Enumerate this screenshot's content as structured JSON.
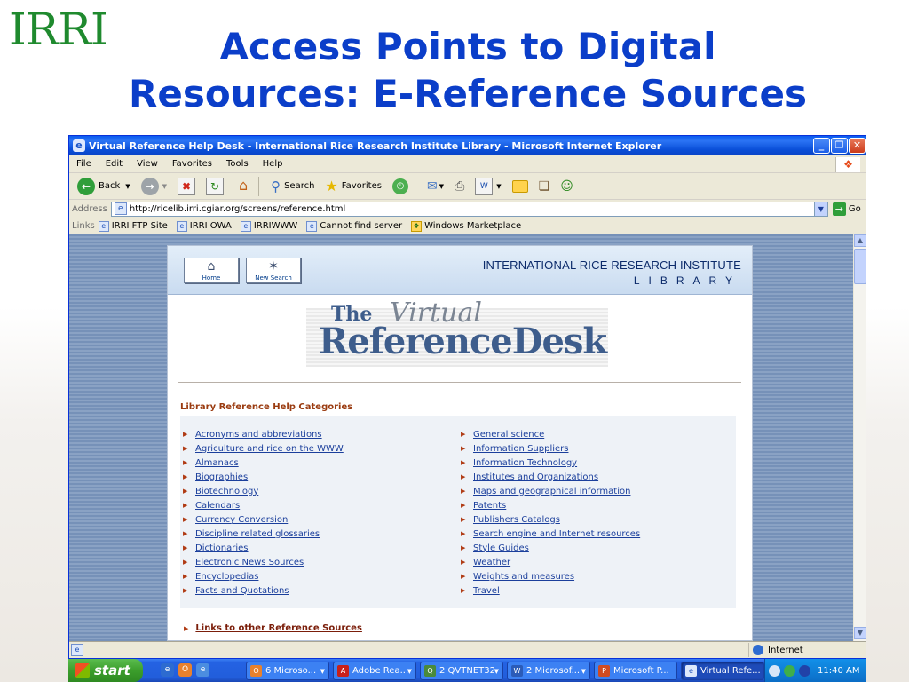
{
  "slide": {
    "logo_text": "IRRI",
    "title_line1": "Access Points to Digital",
    "title_line2": "Resources: E-Reference Sources"
  },
  "window": {
    "title": "Virtual Reference Help Desk - International Rice Research Institute Library - Microsoft Internet Explorer",
    "controls": [
      "minimize",
      "restore",
      "close"
    ]
  },
  "menu": [
    "File",
    "Edit",
    "View",
    "Favorites",
    "Tools",
    "Help"
  ],
  "toolbar": {
    "back": "Back",
    "search": "Search",
    "favorites": "Favorites"
  },
  "address": {
    "label": "Address",
    "url": "http://ricelib.irri.cgiar.org/screens/reference.html",
    "go": "Go"
  },
  "links": {
    "label": "Links",
    "items": [
      "IRRI FTP Site",
      "IRRI OWA",
      "IRRIWWW",
      "Cannot find server",
      "Windows Marketplace"
    ]
  },
  "page": {
    "home_btn": "Home",
    "newsearch_btn": "New Search",
    "institute": "INTERNATIONAL RICE RESEARCH INSTITUTE",
    "library": "LIBRARY",
    "logo_the": "The",
    "logo_virtual": "Virtual",
    "logo_main": "ReferenceDesk",
    "categories_heading": "Library Reference Help Categories",
    "left_categories": [
      "Acronyms and abbreviations",
      "Agriculture and rice on the WWW",
      "Almanacs",
      "Biographies",
      "Biotechnology",
      "Calendars",
      "Currency Conversion",
      "Discipline related glossaries",
      "Dictionaries",
      "Electronic News Sources",
      "Encyclopedias",
      "Facts and Quotations"
    ],
    "right_categories": [
      "General science",
      "Information Suppliers",
      "Information Technology",
      "Institutes and Organizations",
      "Maps and geographical information",
      "Patents",
      "Publishers Catalogs",
      "Search engine and Internet resources",
      "Style Guides",
      "Weather",
      "Weights and measures",
      "Travel"
    ],
    "other_link": "Links to other Reference Sources"
  },
  "status": {
    "zone": "Internet"
  },
  "taskbar": {
    "start": "start",
    "tasks": [
      {
        "label": "6 Microso...",
        "active": false
      },
      {
        "label": "Adobe Rea...",
        "active": false
      },
      {
        "label": "2 QVTNET32",
        "active": false
      },
      {
        "label": "2 Microsof...",
        "active": false
      },
      {
        "label": "Microsoft P...",
        "active": false
      },
      {
        "label": "Virtual Refe...",
        "active": true
      }
    ],
    "clock": "11:40 AM"
  },
  "colors": {
    "title_blue": "#0b3ec9",
    "logo_green": "#1f8a2e",
    "link_blue": "#1b3f9c",
    "heading_brown": "#9a3b10"
  }
}
